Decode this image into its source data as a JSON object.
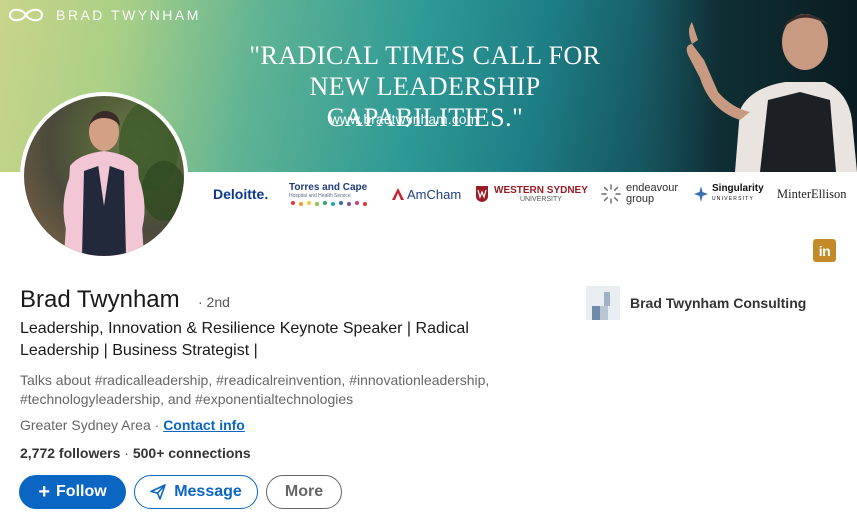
{
  "banner": {
    "brand": "BRAD TWYNHAM",
    "quote_line1": "\"RADICAL TIMES CALL FOR",
    "quote_line2": "NEW LEADERSHIP CAPABILITIES.\"",
    "url": "www.bradtwynham.com"
  },
  "logos": {
    "deloitte": "Deloitte.",
    "torres_line1": "Torres and Cape",
    "torres_line2": "Hospital and Health Service",
    "amcham": "AmCham",
    "wsu_line1": "WESTERN SYDNEY",
    "wsu_line2": "UNIVERSITY",
    "endeavour_line1": "endeavour",
    "endeavour_line2": "group",
    "singularity_line1": "Singularity",
    "singularity_line2": "UNIVERSITY",
    "minter": "MinterEllison"
  },
  "profile": {
    "name": "Brad Twynham",
    "degree": "· 2nd",
    "headline": "Leadership, Innovation & Resilience Keynote Speaker | Radical Leadership | Business Strategist |",
    "talks": "Talks about #radicalleadership, #readicalreinvention, #innovationleadership, #technologyleadership, and #exponentialtechnologies",
    "location": "Greater Sydney Area · ",
    "contact_info": "Contact info",
    "followers": "2,772 followers",
    "connections_sep": " · ",
    "connections": "500+ connections"
  },
  "actions": {
    "follow": "Follow",
    "follow_plus": "+",
    "message": "Message",
    "more": "More"
  },
  "company": {
    "name": "Brad Twynham Consulting"
  },
  "linkedin_badge": "in",
  "colors": {
    "accent": "#0a66c2",
    "linkedin_badge": "#c48a2a"
  }
}
